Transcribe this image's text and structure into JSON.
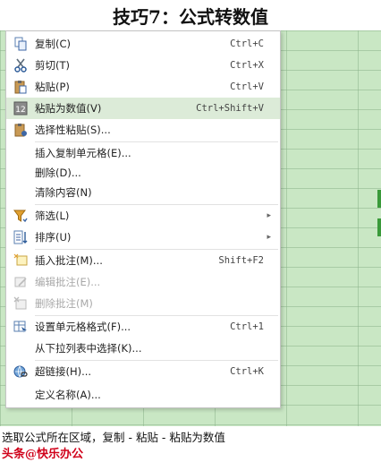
{
  "header": {
    "title": "技巧7：公式转数值"
  },
  "menu": {
    "copy": {
      "label": "复制(C)",
      "shortcut": "Ctrl+C"
    },
    "cut": {
      "label": "剪切(T)",
      "shortcut": "Ctrl+X"
    },
    "paste": {
      "label": "粘贴(P)",
      "shortcut": "Ctrl+V"
    },
    "paste_values": {
      "label": "粘贴为数值(V)",
      "shortcut": "Ctrl+Shift+V"
    },
    "paste_special": {
      "label": "选择性粘贴(S)..."
    },
    "insert_copied": {
      "label": "插入复制单元格(E)..."
    },
    "delete": {
      "label": "删除(D)..."
    },
    "clear": {
      "label": "清除内容(N)"
    },
    "filter": {
      "label": "筛选(L)"
    },
    "sort": {
      "label": "排序(U)"
    },
    "insert_comment": {
      "label": "插入批注(M)...",
      "shortcut": "Shift+F2"
    },
    "edit_comment": {
      "label": "编辑批注(E)..."
    },
    "delete_comment": {
      "label": "删除批注(M)"
    },
    "format_cells": {
      "label": "设置单元格格式(F)...",
      "shortcut": "Ctrl+1"
    },
    "pick_from_list": {
      "label": "从下拉列表中选择(K)..."
    },
    "hyperlink": {
      "label": "超链接(H)...",
      "shortcut": "Ctrl+K"
    },
    "define_name": {
      "label": "定义名称(A)..."
    }
  },
  "caption": {
    "text": "选取公式所在区域，复制 - 粘贴 - 粘贴为数值"
  },
  "watermark": {
    "text": "头条@快乐办公"
  }
}
